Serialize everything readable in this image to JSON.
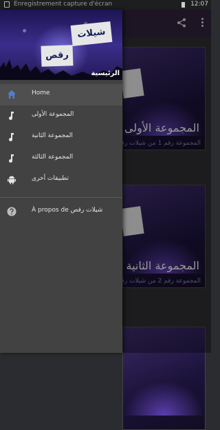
{
  "status_bar": {
    "notification_text": "Enregistrement capture d'écran",
    "time": "12:07"
  },
  "drawer": {
    "header": {
      "sign_top": "شيلات",
      "sign_bottom": "رقص",
      "home_label": "الرئيسية"
    },
    "items": [
      {
        "label": "Home",
        "icon": "home-icon"
      },
      {
        "label": "المجموعة الأولى",
        "icon": "music-note-icon"
      },
      {
        "label": "المجموعة الثانية",
        "icon": "music-note-icon"
      },
      {
        "label": "المجموعة الثالثة",
        "icon": "music-note-icon"
      },
      {
        "label": "تطبيقات أخرى",
        "icon": "android-icon"
      }
    ],
    "about": {
      "label": "À propos de شيلات رقص",
      "icon": "help-icon"
    }
  },
  "cards": [
    {
      "title": "المجموعة الأولى",
      "subtitle": "المجموعة رقم 1 من شيلات رقص"
    },
    {
      "title": "المجموعة الثانية",
      "subtitle": "المجموعة رقم 2 من شيلات رقص"
    }
  ],
  "colors": {
    "drawer_bg": "#424242",
    "selected_bg": "#4f4f4f",
    "appbar": "#2d2138"
  }
}
